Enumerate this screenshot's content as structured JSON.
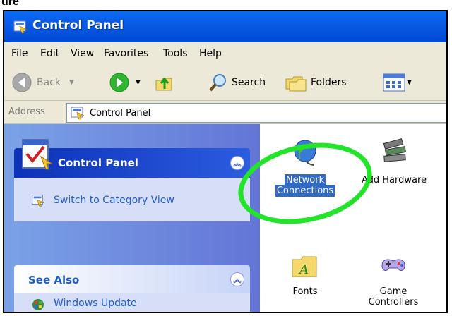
{
  "header_cut_text": "ure",
  "window": {
    "title": "Control Panel"
  },
  "menu": [
    "File",
    "Edit",
    "View",
    "Favorites",
    "Tools",
    "Help"
  ],
  "toolbar": {
    "back": "Back",
    "search": "Search",
    "folders": "Folders"
  },
  "address": {
    "label": "Address",
    "value": "Control Panel"
  },
  "sidebar": {
    "control_panel": {
      "title": "Control Panel",
      "link": "Switch to Category View"
    },
    "see_also": {
      "title": "See Also",
      "link": "Windows Update"
    }
  },
  "items": [
    {
      "line1": "Network",
      "line2": "Connections",
      "icon": "network-globe-icon"
    },
    {
      "line1": "Add Hardware",
      "line2": "",
      "icon": "hardware-icon"
    },
    {
      "line1": "Fonts",
      "line2": "",
      "icon": "fonts-folder-icon"
    },
    {
      "line1": "Game",
      "line2": "Controllers",
      "icon": "gamepad-icon"
    }
  ],
  "colors": {
    "title_bar": "#0a5ae6",
    "highlight_circle": "#22e52a",
    "selection": "#316ac5"
  }
}
